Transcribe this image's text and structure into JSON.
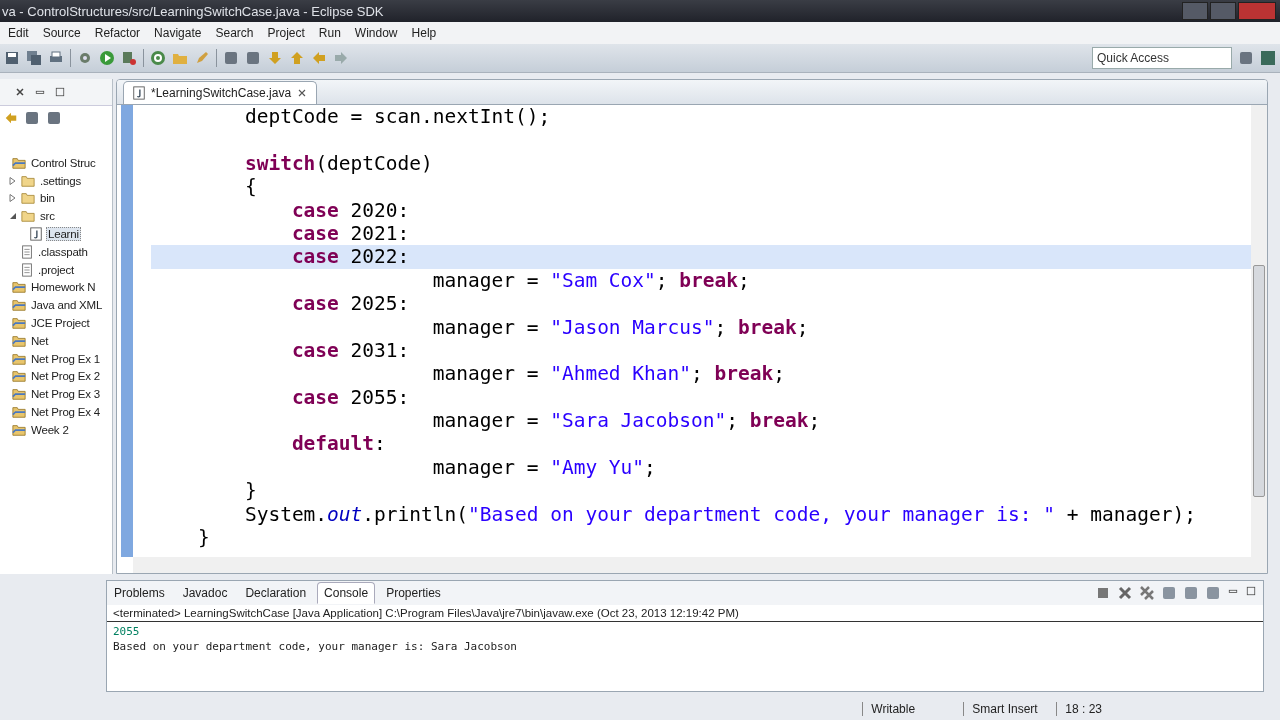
{
  "window": {
    "title": "va - ControlStructures/src/LearningSwitchCase.java - Eclipse SDK"
  },
  "menu": [
    "Edit",
    "Source",
    "Refactor",
    "Navigate",
    "Search",
    "Project",
    "Run",
    "Window",
    "Help"
  ],
  "quick_access": {
    "placeholder": "Quick Access"
  },
  "package_explorer": {
    "items": [
      {
        "label": "Control Struc",
        "kind": "project",
        "children": [
          {
            "label": ".settings",
            "kind": "folder",
            "expanded": false
          },
          {
            "label": "bin",
            "kind": "folder",
            "expanded": false
          },
          {
            "label": "src",
            "kind": "folder",
            "expanded": true,
            "children": [
              {
                "label": "Learni",
                "kind": "java",
                "selected": true
              }
            ]
          },
          {
            "label": ".classpath",
            "kind": "file"
          },
          {
            "label": ".project",
            "kind": "file"
          }
        ]
      },
      {
        "label": "Homework N",
        "kind": "project"
      },
      {
        "label": "Java and XML",
        "kind": "project"
      },
      {
        "label": "JCE Project",
        "kind": "project"
      },
      {
        "label": "Net",
        "kind": "project"
      },
      {
        "label": "Net Prog Ex 1",
        "kind": "project"
      },
      {
        "label": "Net Prog Ex 2",
        "kind": "project"
      },
      {
        "label": "Net Prog Ex 3",
        "kind": "project"
      },
      {
        "label": "Net Prog Ex 4",
        "kind": "project"
      },
      {
        "label": "Week 2",
        "kind": "project"
      }
    ]
  },
  "editor": {
    "tab": {
      "label": "*LearningSwitchCase.java"
    },
    "lines": [
      {
        "current": false,
        "tokens": [
          {
            "t": "        deptCode = scan.nextInt();",
            "kind": "plain"
          }
        ]
      },
      {
        "current": false
      },
      {
        "current": false,
        "tokens": [
          {
            "t": "        switch",
            "kind": "keyword"
          },
          {
            "t": "(deptCode)",
            "kind": "plain"
          }
        ]
      },
      {
        "current": false,
        "tokens": [
          {
            "t": "        {",
            "kind": "plain"
          }
        ]
      },
      {
        "current": false,
        "tokens": [
          {
            "t": "            case",
            "kind": "keyword"
          },
          {
            "t": " 2020:",
            "kind": "plain"
          }
        ]
      },
      {
        "current": false,
        "tokens": [
          {
            "t": "            case",
            "kind": "keyword"
          },
          {
            "t": " 2021:",
            "kind": "plain"
          }
        ]
      },
      {
        "current": true,
        "tokens": [
          {
            "t": "            case",
            "kind": "keyword"
          },
          {
            "t": " 2022:",
            "kind": "plain"
          }
        ]
      },
      {
        "current": false,
        "tokens": [
          {
            "t": "                        manager = ",
            "kind": "plain"
          },
          {
            "t": "\"Sam Cox\"",
            "kind": "string"
          },
          {
            "t": "; ",
            "kind": "plain"
          },
          {
            "t": "break",
            "kind": "keyword"
          },
          {
            "t": ";",
            "kind": "plain"
          }
        ]
      },
      {
        "current": false,
        "tokens": [
          {
            "t": "            case",
            "kind": "keyword"
          },
          {
            "t": " 2025:",
            "kind": "plain"
          }
        ]
      },
      {
        "current": false,
        "tokens": [
          {
            "t": "                        manager = ",
            "kind": "plain"
          },
          {
            "t": "\"Jason Marcus\"",
            "kind": "string"
          },
          {
            "t": "; ",
            "kind": "plain"
          },
          {
            "t": "break",
            "kind": "keyword"
          },
          {
            "t": ";",
            "kind": "plain"
          }
        ]
      },
      {
        "current": false,
        "tokens": [
          {
            "t": "            case",
            "kind": "keyword"
          },
          {
            "t": " 2031:",
            "kind": "plain"
          }
        ]
      },
      {
        "current": false,
        "tokens": [
          {
            "t": "                        manager = ",
            "kind": "plain"
          },
          {
            "t": "\"Ahmed Khan\"",
            "kind": "string"
          },
          {
            "t": "; ",
            "kind": "plain"
          },
          {
            "t": "break",
            "kind": "keyword"
          },
          {
            "t": ";",
            "kind": "plain"
          }
        ]
      },
      {
        "current": false,
        "tokens": [
          {
            "t": "            case",
            "kind": "keyword"
          },
          {
            "t": " 2055:",
            "kind": "plain"
          }
        ]
      },
      {
        "current": false,
        "tokens": [
          {
            "t": "                        manager = ",
            "kind": "plain"
          },
          {
            "t": "\"Sara Jacobson\"",
            "kind": "string"
          },
          {
            "t": "; ",
            "kind": "plain"
          },
          {
            "t": "break",
            "kind": "keyword"
          },
          {
            "t": ";",
            "kind": "plain"
          }
        ]
      },
      {
        "current": false,
        "tokens": [
          {
            "t": "            default",
            "kind": "keyword"
          },
          {
            "t": ":",
            "kind": "plain"
          }
        ]
      },
      {
        "current": false,
        "tokens": [
          {
            "t": "                        manager = ",
            "kind": "plain"
          },
          {
            "t": "\"Amy Yu\"",
            "kind": "string"
          },
          {
            "t": ";",
            "kind": "plain"
          }
        ]
      },
      {
        "current": false,
        "tokens": [
          {
            "t": "        }",
            "kind": "plain"
          }
        ]
      },
      {
        "current": false,
        "tokens": [
          {
            "t": "        System.",
            "kind": "plain"
          },
          {
            "t": "out",
            "kind": "field"
          },
          {
            "t": ".println(",
            "kind": "plain"
          },
          {
            "t": "\"Based on your department code, your manager is: \"",
            "kind": "string"
          },
          {
            "t": " + manager);",
            "kind": "plain"
          }
        ]
      },
      {
        "current": false,
        "tokens": [
          {
            "t": "    }",
            "kind": "plain"
          }
        ]
      }
    ]
  },
  "bottom_panel": {
    "tabs": [
      {
        "label": "Problems",
        "selected": false
      },
      {
        "label": "Javadoc",
        "selected": false
      },
      {
        "label": "Declaration",
        "selected": false
      },
      {
        "label": "Console",
        "selected": true
      },
      {
        "label": "Properties",
        "selected": false
      }
    ],
    "console": {
      "header": "<terminated> LearningSwitchCase [Java Application] C:\\Program Files\\Java\\jre7\\bin\\javaw.exe (Oct 23, 2013 12:19:42 PM)",
      "lines": [
        {
          "text": "2055",
          "kind": "input"
        },
        {
          "text": "Based on your department code, your manager is: Sara Jacobson",
          "kind": "output"
        }
      ]
    }
  },
  "status_bar": [
    "Writable",
    "Smart Insert",
    "18 : 23"
  ]
}
